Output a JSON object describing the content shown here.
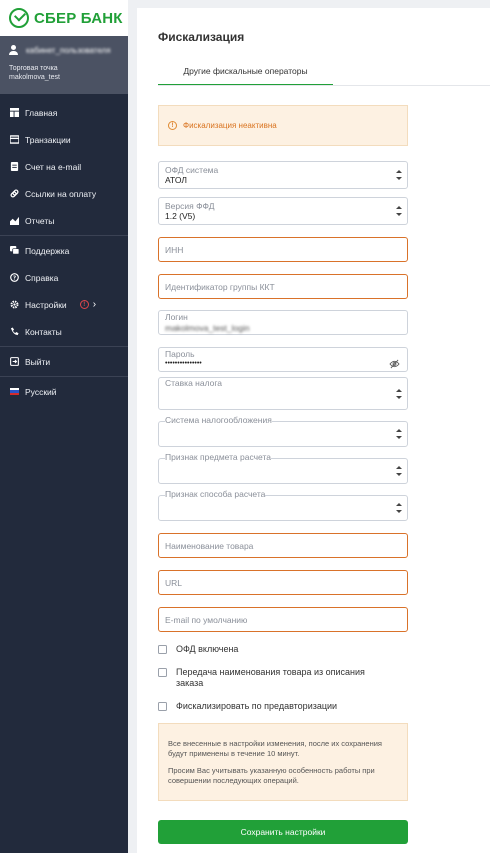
{
  "brand": {
    "logo_text": "СБЕР БАНК",
    "accent_color": "#21a038"
  },
  "account": {
    "user_name": "кабинет_пользователя",
    "store_label": "Торговая точка",
    "store_value": "makolmova_test"
  },
  "sidebar": {
    "items": [
      {
        "label": "Главная",
        "icon": "home-icon"
      },
      {
        "label": "Транзакции",
        "icon": "transactions-icon"
      },
      {
        "label": "Счет на e-mail",
        "icon": "invoice-icon"
      },
      {
        "label": "Ссылки на оплату",
        "icon": "link-icon"
      },
      {
        "label": "Отчеты",
        "icon": "reports-icon"
      },
      {
        "label": "Поддержка",
        "icon": "chat-icon"
      },
      {
        "label": "Справка",
        "icon": "help-icon"
      },
      {
        "label": "Настройки",
        "icon": "gear-icon",
        "warning": "!",
        "chevron": "›"
      },
      {
        "label": "Контакты",
        "icon": "phone-icon"
      },
      {
        "label": "Выйти",
        "icon": "logout-icon"
      },
      {
        "label": "Русский",
        "icon": "ru-flag-icon"
      }
    ]
  },
  "page": {
    "title": "Фискализация",
    "tabs": [
      {
        "label": "Другие фискальные операторы",
        "active": true
      }
    ],
    "alert": {
      "icon": "!",
      "text": "Фискализация неактивна"
    }
  },
  "form": {
    "ofd_system": {
      "label": "ОФД система",
      "value": "АТОЛ"
    },
    "ffd_version": {
      "label": "Версия ФФД",
      "value": "1.2 (V5)"
    },
    "inn": {
      "placeholder": "ИНН"
    },
    "kkt_group": {
      "placeholder": "Идентификатор группы ККТ"
    },
    "login": {
      "label": "Логин",
      "value": "makolmova_test_login"
    },
    "password": {
      "label": "Пароль",
      "value": "•••••••••••••••"
    },
    "tax_rate": {
      "label": "Ставка налога",
      "value": ""
    },
    "tax_system": {
      "label": "Система налогообложения",
      "value": ""
    },
    "payment_object": {
      "label": "Признак предмета расчета",
      "value": ""
    },
    "payment_method": {
      "label": "Признак способа расчета",
      "value": ""
    },
    "product_name": {
      "placeholder": "Наименование товара"
    },
    "url": {
      "placeholder": "URL"
    },
    "default_email": {
      "placeholder": "E-mail по умолчанию"
    },
    "checkboxes": {
      "ofd_enabled": "ОФД включена",
      "pass_description": "Передача наименования товара из описания заказа",
      "fiscalize_preauth": "Фискализировать по предавторизации"
    },
    "note": {
      "line1": "Все внесенные в настройки изменения, после их сохранения будут применены в течение 10 минут.",
      "line2": "Просим Вас учитывать указанную особенность работы при совершении последующих операций."
    },
    "save_label": "Сохранить настройки"
  }
}
